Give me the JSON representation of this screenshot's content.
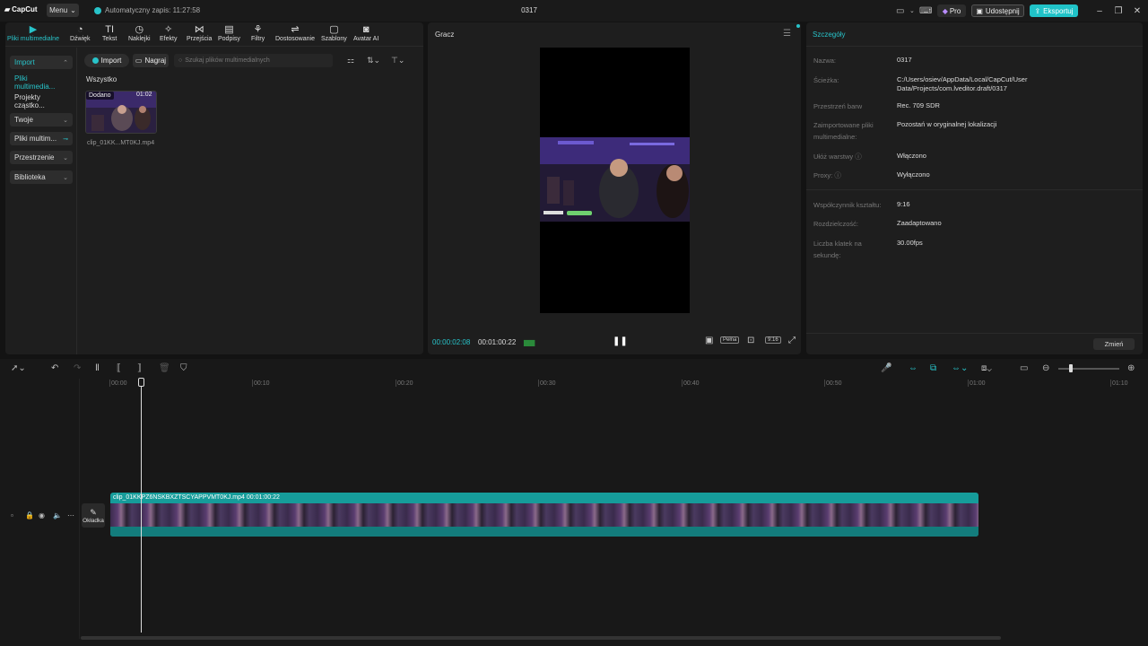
{
  "app": {
    "logo": "CapCut",
    "menu_label": "Menu",
    "autosave": "Automatyczny zapis: 11:27:58",
    "project_title": "0317"
  },
  "topbar": {
    "pro": "Pro",
    "share": "Udostępnij",
    "export": "Eksportuj"
  },
  "tabs": [
    {
      "label": "Pliki multimedialne",
      "icon": "media-icon"
    },
    {
      "label": "Dźwięk",
      "icon": "audio-icon"
    },
    {
      "label": "Tekst",
      "icon": "text-icon"
    },
    {
      "label": "Naklejki",
      "icon": "sticker-icon"
    },
    {
      "label": "Efekty",
      "icon": "effects-icon"
    },
    {
      "label": "Przejścia",
      "icon": "transitions-icon"
    },
    {
      "label": "Podpisy",
      "icon": "captions-icon"
    },
    {
      "label": "Filtry",
      "icon": "filters-icon"
    },
    {
      "label": "Dostosowanie",
      "icon": "adjust-icon"
    },
    {
      "label": "Szablony",
      "icon": "templates-icon"
    },
    {
      "label": "Avatar AI",
      "icon": "avatar-icon"
    }
  ],
  "sidenav": {
    "import": "Import",
    "media_files": "Pliki multimedia...",
    "particle_projects": "Projekty cząstko...",
    "yours": "Twoje",
    "media_files2": "Pliki multim...",
    "spaces": "Przestrzenie",
    "library": "Biblioteka"
  },
  "media": {
    "import_btn": "Import",
    "record_btn": "Nagraj",
    "search_placeholder": "Szukaj plików multimedialnych",
    "section": "Wszystko",
    "clip_added": "Dodano",
    "clip_duration": "01:02",
    "clip_name": "clip_01KK...MT0KJ.mp4"
  },
  "player": {
    "title": "Gracz",
    "time_current": "00:00:02:08",
    "time_total": "00:01:00:22",
    "full_label": "Pełna",
    "ratio_label": "9:16"
  },
  "details": {
    "title": "Szczegóły",
    "rows": [
      {
        "label": "Nazwa:",
        "value": "0317"
      },
      {
        "label": "Ścieżka:",
        "value": "C:/Users/osiev/AppData/Local/CapCut/User Data/Projects/com.lveditor.draft/0317"
      },
      {
        "label": "Przestrzeń barw",
        "value": "Rec. 709 SDR"
      },
      {
        "label": "Zaimportowane pliki multimedialne:",
        "value": "Pozostań w oryginalnej lokalizacji"
      },
      {
        "label": "Ułóż warstwy",
        "value": "Włączono"
      },
      {
        "label": "Proxy:",
        "value": "Wyłączono"
      },
      {
        "label": "Współczynnik kształtu:",
        "value": "9:16"
      },
      {
        "label": "Rozdzielczość:",
        "value": "Zaadaptowano"
      },
      {
        "label": "Liczba klatek na sekundę:",
        "value": "30.00fps"
      }
    ],
    "change_btn": "Zmień"
  },
  "timeline": {
    "ruler": [
      "00:00",
      "00:10",
      "00:20",
      "00:30",
      "00:40",
      "00:50",
      "01:00",
      "01:10"
    ],
    "track_label": "clip_01KKPZ6NSKBXZTSCYAPPVMT0KJ.mp4",
    "track_duration": "00:01:00:22",
    "cover_label": "Okładka"
  },
  "colors": {
    "accent": "#20c3c8",
    "panel": "#1e1e1e",
    "background": "#131313",
    "track": "#169c9a"
  }
}
